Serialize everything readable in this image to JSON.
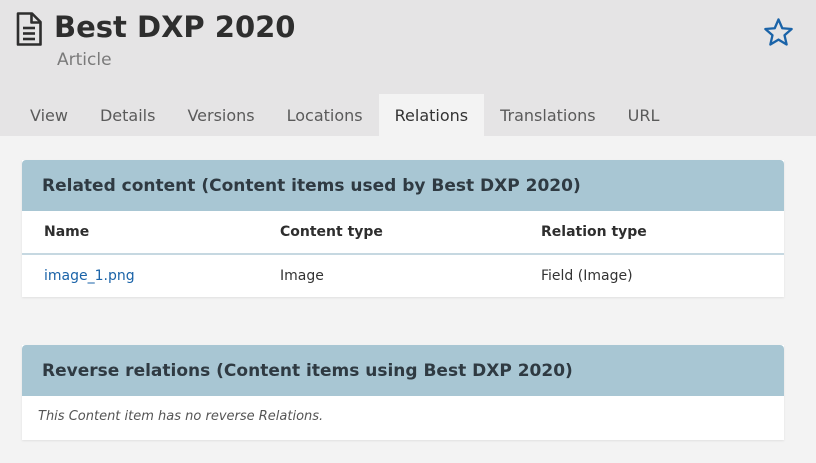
{
  "header": {
    "title": "Best DXP 2020",
    "subtitle": "Article",
    "icons": {
      "content_type": "document-icon",
      "bookmark": "star-icon"
    },
    "accent_color": "#1a63a8"
  },
  "tabs": [
    {
      "label": "View",
      "active": false
    },
    {
      "label": "Details",
      "active": false
    },
    {
      "label": "Versions",
      "active": false
    },
    {
      "label": "Locations",
      "active": false
    },
    {
      "label": "Relations",
      "active": true
    },
    {
      "label": "Translations",
      "active": false
    },
    {
      "label": "URL",
      "active": false
    }
  ],
  "related": {
    "heading": "Related content (Content items used by Best DXP 2020)",
    "columns": [
      "Name",
      "Content type",
      "Relation type"
    ],
    "rows": [
      {
        "name": "image_1.png",
        "content_type": "Image",
        "relation_type": "Field (Image)"
      }
    ]
  },
  "reverse": {
    "heading": "Reverse relations (Content items using Best DXP 2020)",
    "empty_message": "This Content item has no reverse Relations."
  }
}
